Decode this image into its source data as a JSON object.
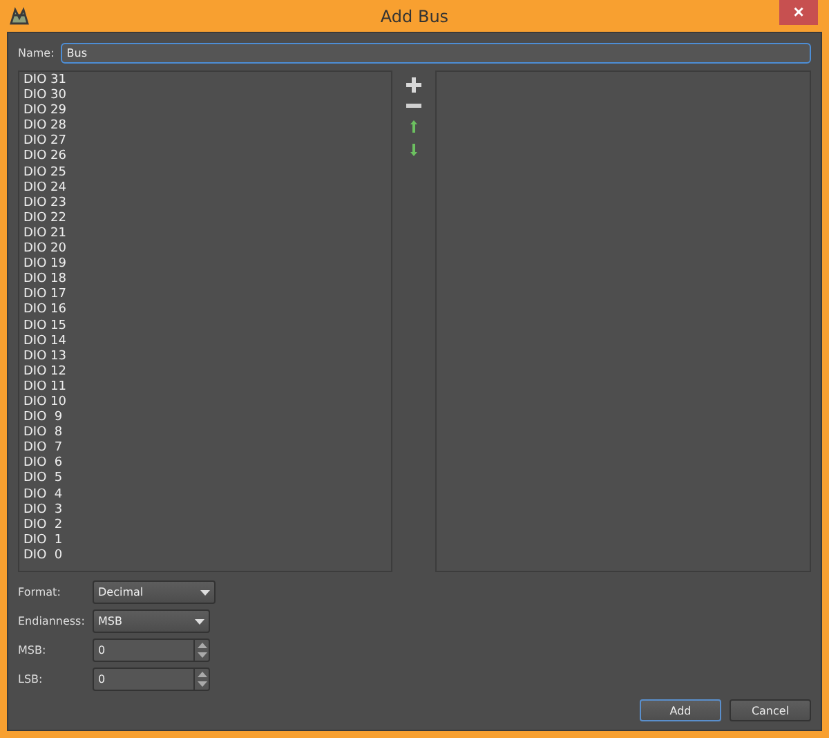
{
  "window": {
    "title": "Add Bus",
    "close": "×"
  },
  "name_field": {
    "label": "Name:",
    "value": "Bus"
  },
  "signals": [
    "DIO 31",
    "DIO 30",
    "DIO 29",
    "DIO 28",
    "DIO 27",
    "DIO 26",
    "DIO 25",
    "DIO 24",
    "DIO 23",
    "DIO 22",
    "DIO 21",
    "DIO 20",
    "DIO 19",
    "DIO 18",
    "DIO 17",
    "DIO 16",
    "DIO 15",
    "DIO 14",
    "DIO 13",
    "DIO 12",
    "DIO 11",
    "DIO 10",
    "DIO  9",
    "DIO  8",
    "DIO  7",
    "DIO  6",
    "DIO  5",
    "DIO  4",
    "DIO  3",
    "DIO  2",
    "DIO  1",
    "DIO  0"
  ],
  "settings": [
    {
      "kind": "dropdown",
      "label": "Format:",
      "value": "Decimal"
    },
    {
      "kind": "dropdown",
      "label": "Endianness:",
      "value": "MSB"
    },
    {
      "kind": "spinbox",
      "label": "MSB:",
      "value": "0"
    },
    {
      "kind": "spinbox",
      "label": "LSB:",
      "value": "0"
    }
  ],
  "buttons": [
    {
      "label": "Add",
      "selected": true
    },
    {
      "label": "Cancel",
      "selected": false
    }
  ]
}
